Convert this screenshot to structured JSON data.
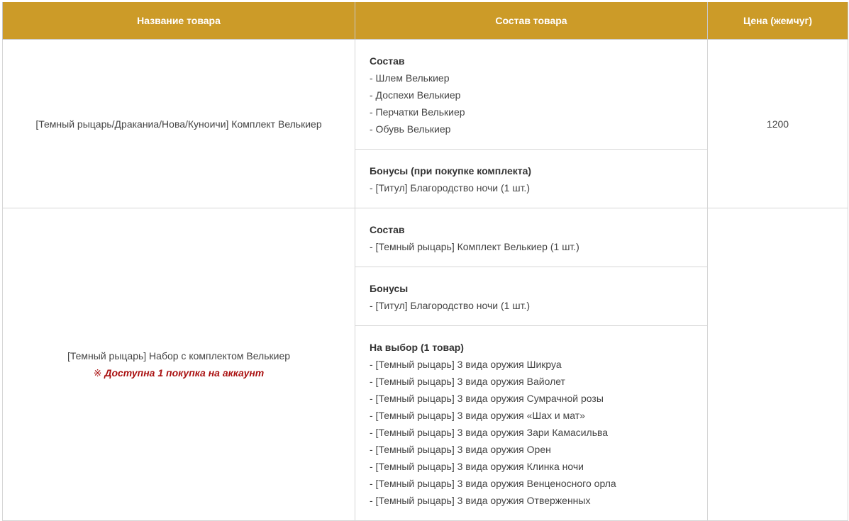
{
  "headers": {
    "name": "Название товара",
    "composition": "Состав товара",
    "price": "Цена (жемчуг)"
  },
  "products": [
    {
      "name": "[Темный рыцарь/Драканиа/Нова/Куноичи] Комплект Велькиер",
      "price": "1200",
      "sections": [
        {
          "title": "Состав",
          "items": [
            "- Шлем Велькиер",
            "- Доспехи Велькиер",
            "- Перчатки Велькиер",
            "- Обувь Велькиер"
          ]
        },
        {
          "title": "Бонусы (при покупке комплекта)",
          "items": [
            "- [Титул] Благородство ночи (1 шт.)"
          ]
        }
      ]
    },
    {
      "name": "[Темный рыцарь] Набор с комплектом Велькиер",
      "notice_mark": "※",
      "notice": "Доступна 1 покупка на аккаунт",
      "price": "",
      "sections": [
        {
          "title": "Состав",
          "items": [
            "- [Темный рыцарь] Комплект Велькиер (1 шт.)"
          ]
        },
        {
          "title": "Бонусы",
          "items": [
            "- [Титул] Благородство ночи (1 шт.)"
          ]
        },
        {
          "title": "На выбор (1 товар)",
          "items": [
            "- [Темный рыцарь] 3 вида оружия Шикруа",
            "- [Темный рыцарь] 3 вида оружия Вайолет",
            "- [Темный рыцарь] 3 вида оружия Сумрачной розы",
            "- [Темный рыцарь] 3 вида оружия «Шах и мат»",
            "- [Темный рыцарь] 3 вида оружия Зари Камасильва",
            "- [Темный рыцарь] 3 вида оружия Орен",
            "- [Темный рыцарь] 3 вида оружия Клинка ночи",
            "- [Темный рыцарь] 3 вида оружия Венценосного орла",
            "- [Темный рыцарь] 3 вида оружия Отверженных"
          ]
        }
      ]
    }
  ],
  "colors": {
    "header_bg": "#cc9b28",
    "header_text": "#ffffff",
    "notice": "#aa1111",
    "border": "#d6d6d6"
  }
}
